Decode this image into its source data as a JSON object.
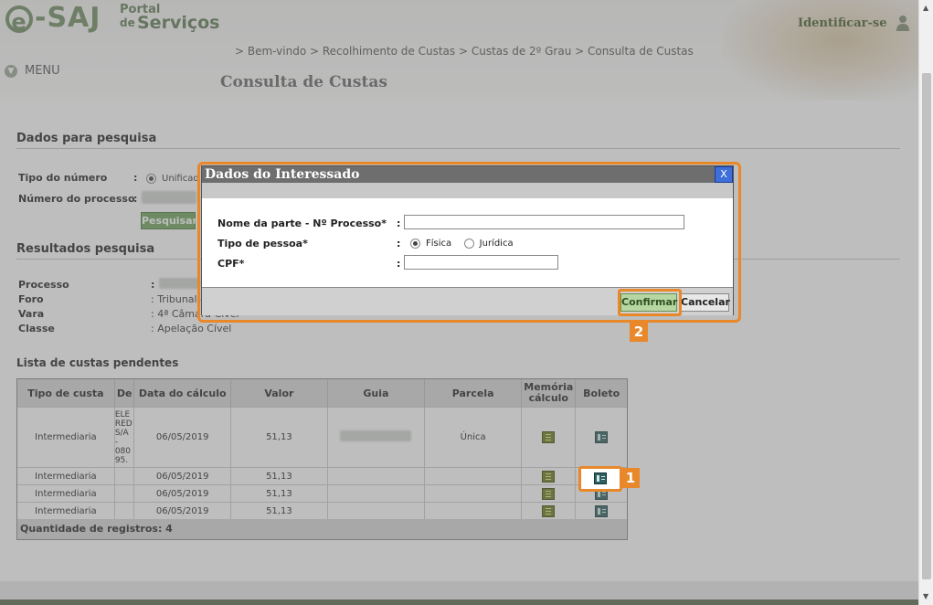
{
  "header": {
    "logo_text": "-SAJ",
    "logo_e": "e",
    "portal_line1": "Portal",
    "portal_line2": "de",
    "portal_line3": "Serviços",
    "identify_label": "Identificar-se",
    "menu_label": "MENU",
    "breadcrumb": "> Bem-vindo > Recolhimento de Custas > Custas de 2º Grau > Consulta de Custas",
    "page_title": "Consulta de Custas"
  },
  "search": {
    "title": "Dados para pesquisa",
    "tipo_label": "Tipo do número",
    "tipo_value": "Unificad",
    "numero_label": "Número do processo",
    "search_button": "Pesquisar"
  },
  "results": {
    "title": "Resultados pesquisa",
    "processo_label": "Processo",
    "foro_label": "Foro",
    "foro_value": ": Tribunal d",
    "vara_label": "Vara",
    "vara_value": ": 4ª Câmara Cível",
    "classe_label": "Classe",
    "classe_value": ": Apelação Cível",
    "colon": ":"
  },
  "custas": {
    "title": "Lista de custas pendentes",
    "columns": [
      "Tipo de custa",
      "De",
      "Data do cálculo",
      "Valor",
      "Guia",
      "Parcela",
      "Memória cálculo",
      "Boleto"
    ],
    "rows": [
      {
        "tipo": "Intermediaria",
        "desc": "ELE RED S/A - 080 95.",
        "data": "06/05/2019",
        "valor": "51,13",
        "parcela": "Única"
      },
      {
        "tipo": "Intermediaria",
        "desc": "",
        "data": "06/05/2019",
        "valor": "51,13",
        "parcela": ""
      },
      {
        "tipo": "Intermediaria",
        "desc": "",
        "data": "06/05/2019",
        "valor": "51,13",
        "parcela": ""
      },
      {
        "tipo": "Intermediaria",
        "desc": "",
        "data": "06/05/2019",
        "valor": "51,13",
        "parcela": ""
      }
    ],
    "footer": "Quantidade de registros: 4"
  },
  "modal": {
    "title": "Dados do Interessado",
    "close_label": "X",
    "nome_label": "Nome da parte - Nº Processo*",
    "nome_value": "",
    "tipo_label": "Tipo de pessoa*",
    "tipo_options": [
      "Física",
      "Jurídica"
    ],
    "cpf_label": "CPF*",
    "cpf_value": "",
    "colon": ":",
    "confirm_button": "Confirmar",
    "cancel_button": "Cancelar"
  },
  "callouts": [
    "1",
    "2"
  ],
  "colors": {
    "accent": "#e8882a",
    "brand_green": "#6d8a61"
  }
}
